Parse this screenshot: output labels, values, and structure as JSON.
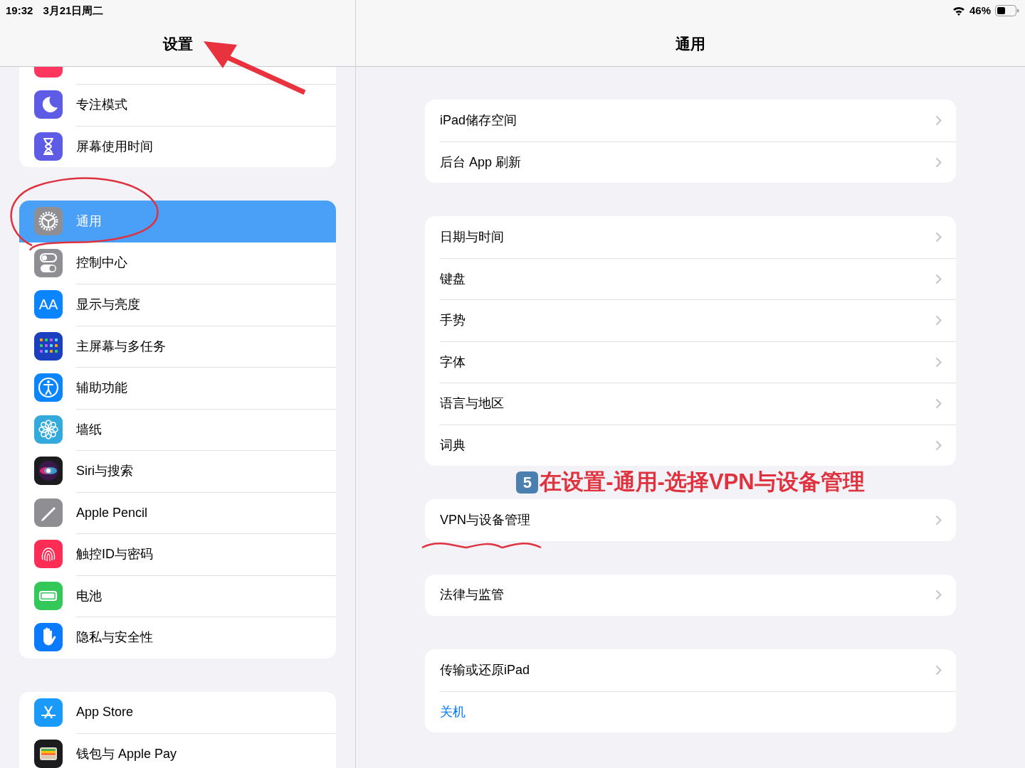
{
  "status_bar": {
    "time": "19:32",
    "date": "3月21日周二",
    "battery_text": "46%"
  },
  "sidebar": {
    "title": "设置",
    "groups": [
      {
        "items": [
          {
            "label": "专注模式",
            "selected": false
          },
          {
            "label": "屏幕使用时间",
            "selected": false
          }
        ]
      },
      {
        "items": [
          {
            "label": "通用",
            "selected": true
          },
          {
            "label": "控制中心",
            "selected": false
          },
          {
            "label": "显示与亮度",
            "selected": false,
            "icon_text": "AA"
          },
          {
            "label": "主屏幕与多任务",
            "selected": false
          },
          {
            "label": "辅助功能",
            "selected": false
          },
          {
            "label": "墙纸",
            "selected": false
          },
          {
            "label": "Siri与搜索",
            "selected": false
          },
          {
            "label": "Apple Pencil",
            "selected": false
          },
          {
            "label": "触控ID与密码",
            "selected": false
          },
          {
            "label": "电池",
            "selected": false
          },
          {
            "label": "隐私与安全性",
            "selected": false
          }
        ]
      },
      {
        "items": [
          {
            "label": "App Store",
            "selected": false
          },
          {
            "label": "钱包与 Apple Pay",
            "selected": false
          }
        ]
      }
    ]
  },
  "detail": {
    "title": "通用",
    "groups": [
      {
        "items": [
          {
            "label": "iPad储存空间",
            "kind": "link"
          },
          {
            "label": "后台 App 刷新",
            "kind": "link"
          }
        ]
      },
      {
        "items": [
          {
            "label": "日期与时间",
            "kind": "link"
          },
          {
            "label": "键盘",
            "kind": "link"
          },
          {
            "label": "手势",
            "kind": "link"
          },
          {
            "label": "字体",
            "kind": "link"
          },
          {
            "label": "语言与地区",
            "kind": "link"
          },
          {
            "label": "词典",
            "kind": "link"
          }
        ]
      },
      {
        "items": [
          {
            "label": "VPN与设备管理",
            "kind": "link"
          }
        ]
      },
      {
        "items": [
          {
            "label": "法律与监管",
            "kind": "link"
          }
        ]
      },
      {
        "items": [
          {
            "label": "传输或还原iPad",
            "kind": "link"
          },
          {
            "label": "关机",
            "kind": "action"
          }
        ]
      }
    ]
  },
  "annotation": {
    "badge": "5",
    "text": "在设置-通用-选择VPN与设备管理"
  }
}
